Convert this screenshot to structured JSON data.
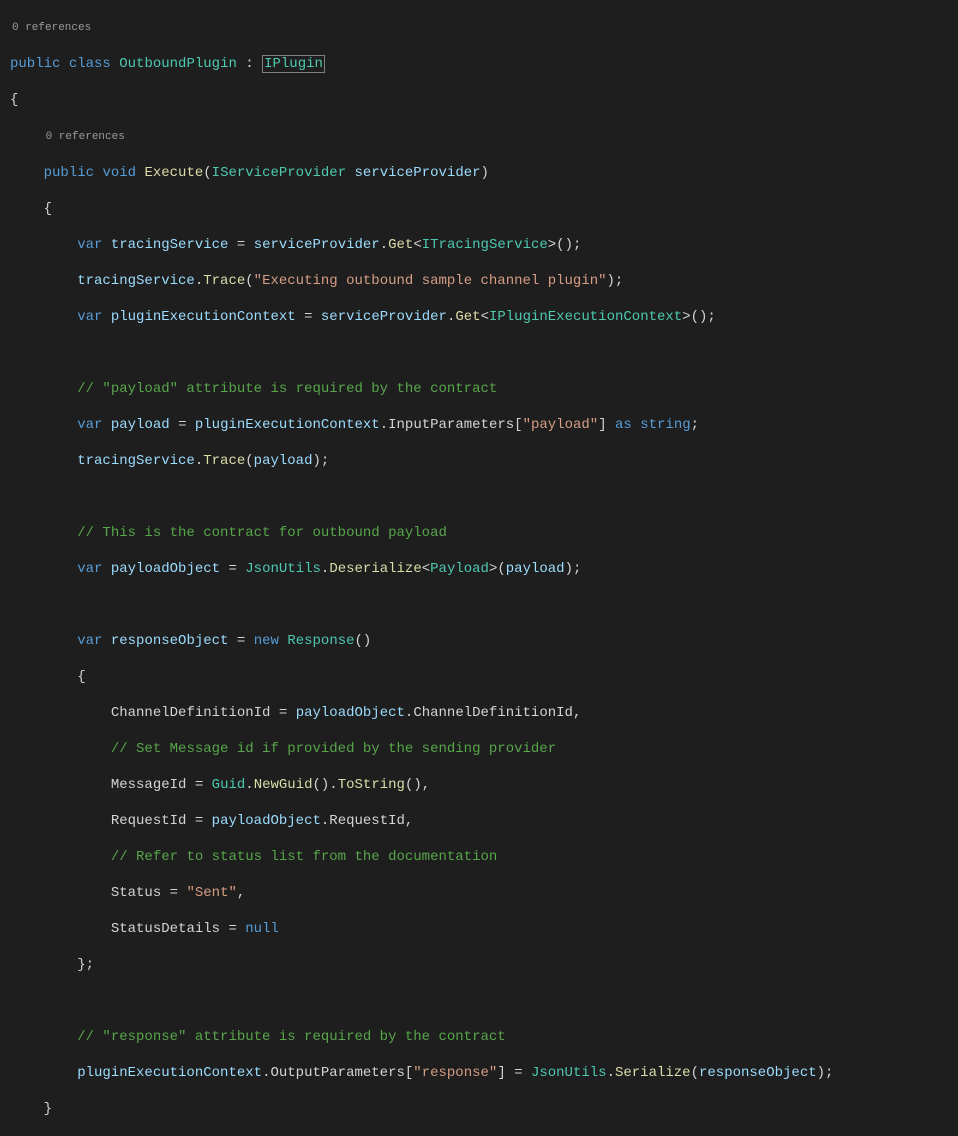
{
  "codelens": {
    "line0": "0 references",
    "line3": "0 references"
  },
  "t": {
    "public": "public",
    "class": "class",
    "void": "void",
    "var": "var",
    "new": "new",
    "as": "as",
    "null": "null",
    "string_kw": "string",
    "OutboundPlugin": "OutboundPlugin",
    "IPlugin": "IPlugin",
    "Execute": "Execute",
    "IServiceProvider": "IServiceProvider",
    "serviceProvider": "serviceProvider",
    "tracingService": "tracingService",
    "Get": "Get",
    "ITracingService": "ITracingService",
    "Trace": "Trace",
    "str_exec": "\"Executing outbound sample channel plugin\"",
    "pluginExecutionContext": "pluginExecutionContext",
    "IPluginExecutionContext": "IPluginExecutionContext",
    "com_payload_contract": "// \"payload\" attribute is required by the contract",
    "payload": "payload",
    "InputParameters": "InputParameters",
    "str_payload": "\"payload\"",
    "com_outbound": "// This is the contract for outbound payload",
    "payloadObject": "payloadObject",
    "JsonUtils": "JsonUtils",
    "Deserialize": "Deserialize",
    "Payload": "Payload",
    "responseObject": "responseObject",
    "Response": "Response",
    "ChannelDefinitionId": "ChannelDefinitionId",
    "com_msgid": "// Set Message id if provided by the sending provider",
    "MessageId": "MessageId",
    "Guid": "Guid",
    "NewGuid": "NewGuid",
    "ToString": "ToString",
    "RequestId": "RequestId",
    "com_status": "// Refer to status list from the documentation",
    "Status": "Status",
    "str_sent": "\"Sent\"",
    "StatusDetails": "StatusDetails",
    "com_response": "// \"response\" attribute is required by the contract",
    "OutputParameters": "OutputParameters",
    "str_response": "\"response\"",
    "Serialize": "Serialize"
  }
}
